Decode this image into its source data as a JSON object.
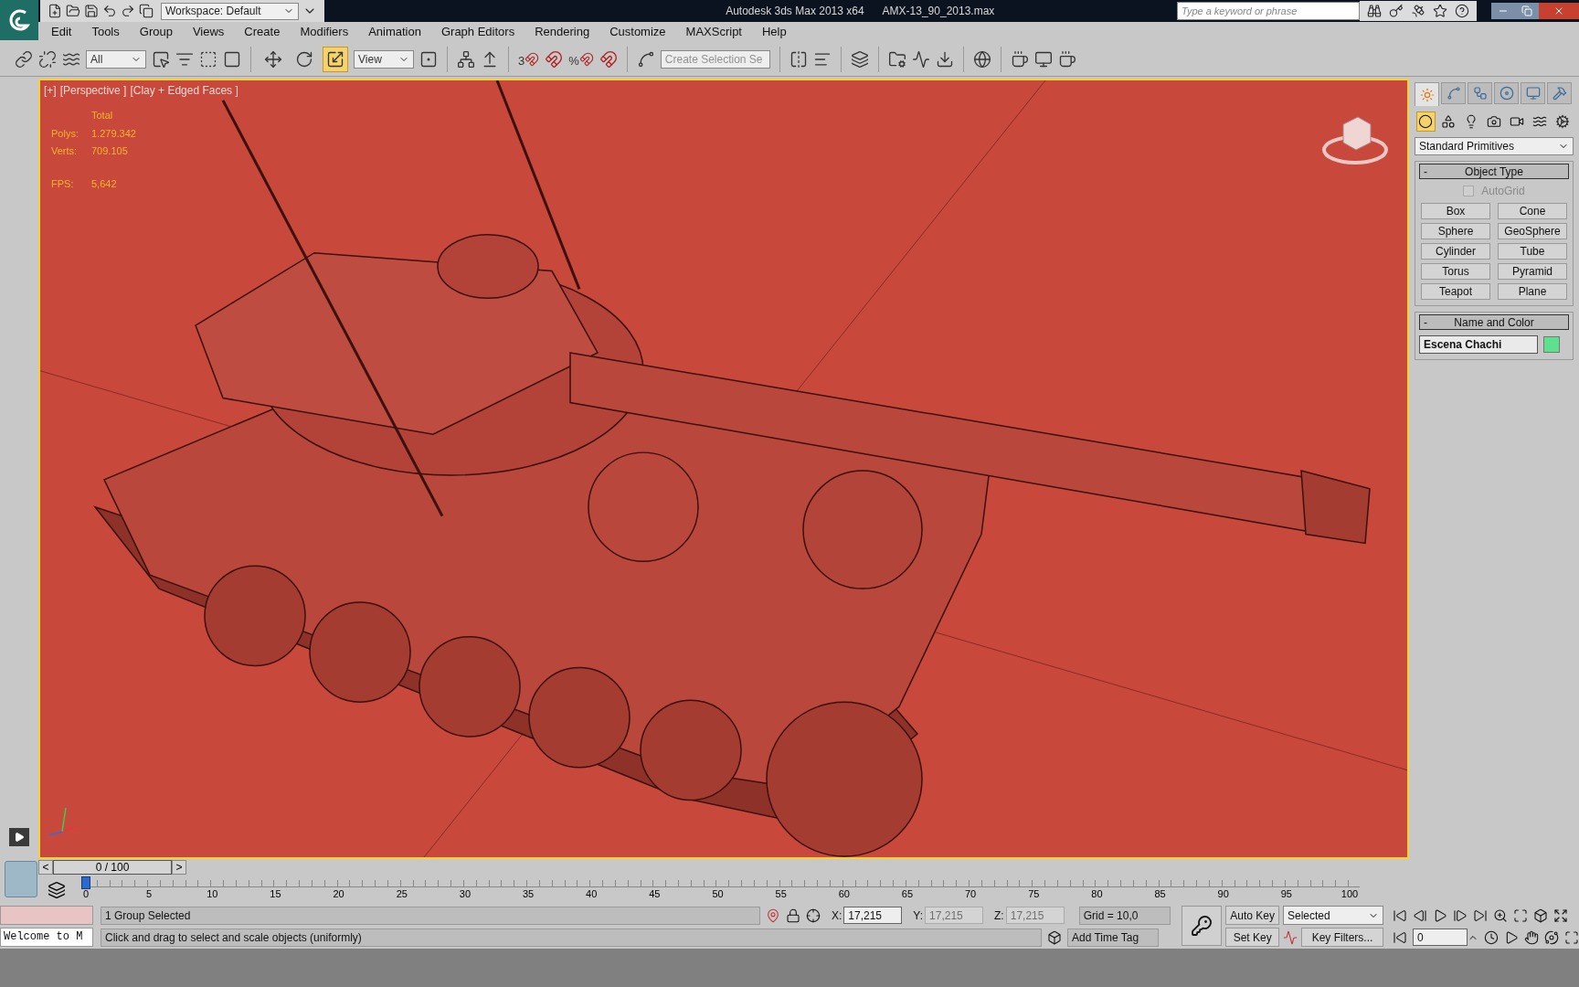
{
  "title_bar": {
    "workspace": "Workspace: Default",
    "app_title": "Autodesk 3ds Max  2013 x64",
    "file_name": "AMX-13_90_2013.max",
    "search": {
      "placeholder": "Type a keyword or phrase"
    }
  },
  "menu": [
    "Edit",
    "Tools",
    "Group",
    "Views",
    "Create",
    "Modifiers",
    "Animation",
    "Graph Editors",
    "Rendering",
    "Customize",
    "MAXScript",
    "Help"
  ],
  "toolbar": {
    "selection_filter": "All",
    "transform_tools": [
      {
        "selected": false
      },
      {
        "selected": false
      },
      {
        "selected": true
      }
    ],
    "reference_coord": "View",
    "snap_label": "3",
    "percent_label": "%",
    "named_selection": {
      "placeholder": "Create Selection Se"
    }
  },
  "viewport": {
    "active": true,
    "labels": [
      "[+]",
      "[Perspective ]",
      "[Clay + Edged Faces ]"
    ],
    "stats_header": "Total",
    "stats": [
      {
        "label": "Polys:",
        "value": "1.279.342"
      },
      {
        "label": "Verts:",
        "value": "709.105"
      }
    ],
    "fps": {
      "label": "FPS:",
      "value": "5,642"
    }
  },
  "command_panel": {
    "tabs": [
      {
        "selected": true
      },
      {
        "selected": false
      },
      {
        "selected": false
      },
      {
        "selected": false
      },
      {
        "selected": false
      },
      {
        "selected": false
      }
    ],
    "categories": [
      {
        "selected": true
      },
      {
        "selected": false
      },
      {
        "selected": false
      },
      {
        "selected": false
      },
      {
        "selected": false
      },
      {
        "selected": false
      },
      {
        "selected": false
      }
    ],
    "type_dropdown": "Standard Primitives",
    "object_type": {
      "toggle": "-",
      "title": "Object Type",
      "autogrid": {
        "label": "AutoGrid",
        "checked": false,
        "disabled": true
      },
      "buttons": [
        "Box",
        "Cone",
        "Sphere",
        "GeoSphere",
        "Cylinder",
        "Tube",
        "Torus",
        "Pyramid",
        "Teapot",
        "Plane"
      ]
    },
    "name_and_color": {
      "toggle": "-",
      "title": "Name and Color",
      "name": "Escena Chachi",
      "color": "#5ee08e"
    }
  },
  "timeline": {
    "prev": "<",
    "next": ">",
    "frame": "0 / 100",
    "level": 0,
    "ticks": [
      "0",
      "5",
      "10",
      "15",
      "20",
      "25",
      "30",
      "35",
      "40",
      "45",
      "50",
      "55",
      "60",
      "65",
      "70",
      "75",
      "80",
      "85",
      "90",
      "95",
      "100"
    ]
  },
  "status": {
    "maxscript": "Welcome to M",
    "selection": "1 Group Selected",
    "prompt": "Click and drag to select and scale objects (uniformly)",
    "coords": [
      {
        "label": "X:",
        "value": "17,215",
        "disabled": false
      },
      {
        "label": "Y:",
        "value": "17,215",
        "disabled": true
      },
      {
        "label": "Z:",
        "value": "17,215",
        "disabled": true
      }
    ],
    "grid": "Grid = 10,0",
    "add_time_tag": "Add Time Tag",
    "auto_key": "Auto Key",
    "key_mode": "Selected",
    "set_key": "Set Key",
    "key_filters": "Key Filters...",
    "current_frame": "0"
  }
}
